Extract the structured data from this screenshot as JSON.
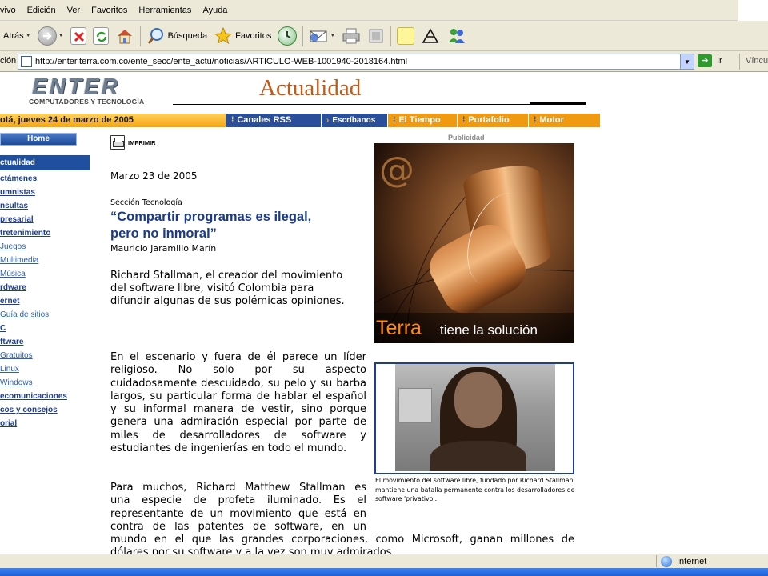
{
  "menubar": {
    "items": [
      "vivo",
      "Edición",
      "Ver",
      "Favoritos",
      "Herramientas",
      "Ayuda"
    ]
  },
  "toolbar": {
    "back_label": "Atrás",
    "search_label": "Búsqueda",
    "favorites_label": "Favoritos"
  },
  "addressbar": {
    "label": "ción",
    "url": "http://enter.terra.com.co/ente_secc/ente_actu/noticias/ARTICULO-WEB-1001940-2018164.html",
    "go_label": "Ir",
    "links_label": "Víncul"
  },
  "site": {
    "logo_text": "ENTER",
    "logo_subtext": "COMPUTADORES Y TECNOLOGÍA",
    "section_title": "Actualidad",
    "date": "otá, jueves 24 de marzo de 2005",
    "nav_tabs": [
      "Canales RSS",
      "Escríbanos",
      "El Tiempo",
      "Portafolio",
      "Motor"
    ],
    "accent_orange": "#c25a18",
    "accent_blue": "#1f4f9e"
  },
  "sidebar": {
    "home_label": "Home",
    "active_label": "ctualidad",
    "links": [
      {
        "label": "ctámenes",
        "sub": false
      },
      {
        "label": "umnistas",
        "sub": false
      },
      {
        "label": "nsultas",
        "sub": false
      },
      {
        "label": "presarial",
        "sub": false
      },
      {
        "label": "tretenimiento",
        "sub": false
      },
      {
        "label": "Juegos",
        "sub": true
      },
      {
        "label": "Multimedia",
        "sub": true
      },
      {
        "label": "Música",
        "sub": true
      },
      {
        "label": "rdware",
        "sub": false
      },
      {
        "label": "ernet",
        "sub": false
      },
      {
        "label": "Guía de sitios",
        "sub": true
      },
      {
        "label": "C",
        "sub": false
      },
      {
        "label": "ftware",
        "sub": false
      },
      {
        "label": "Gratuitos",
        "sub": true
      },
      {
        "label": "Linux",
        "sub": true
      },
      {
        "label": "Windows",
        "sub": true
      },
      {
        "label": "ecomunicaciones",
        "sub": false
      },
      {
        "label": "cos y consejos",
        "sub": false
      },
      {
        "label": "orial",
        "sub": false
      }
    ]
  },
  "article": {
    "print_label": "IMPRIMIR",
    "date": "Marzo 23 de 2005",
    "section": "Sección Tecnología",
    "headline_line1": "“Compartir programas es ilegal,",
    "headline_line2": "pero no inmoral”",
    "author": "Mauricio Jaramillo Marín",
    "lead_lines": [
      "Richard Stallman, el creador del movimiento",
      "del software libre, visitó Colombia para",
      "difundir algunas de sus polémicas opiniones."
    ],
    "p1": "En el escenario y fuera de él parece un líder religioso. No solo por su aspecto cuidadosamente descuidado, su pelo y su barba largos, su particular forma de hablar el español y su informal manera de vestir, sino porque genera una admiración especial por parte de miles de desarrolladores de software y estudiantes de ingenierías en todo el mundo.",
    "p2_lines": [
      "Para muchos, Richard Matthew Stallman es",
      "una especie de profeta iluminado. Es el",
      "representante de un movimiento que está en",
      "contra de las patentes de software, en un"
    ],
    "p2_wide_line": "mundo en el que las grandes corporaciones, como Microsoft, ganan millones de",
    "p2_cut_line": "dólares por su software y a la vez son muy admirados"
  },
  "ad": {
    "publicidad_label": "Publicidad",
    "brand": "Terra",
    "tagline": "tiene la solución"
  },
  "photo": {
    "caption": "El movimiento del software libre, fundado por Richard Stallman, mantiene una batalla permanente contra los desarrolladores de software 'privativo'."
  },
  "statusbar": {
    "zone_label": "Internet"
  }
}
